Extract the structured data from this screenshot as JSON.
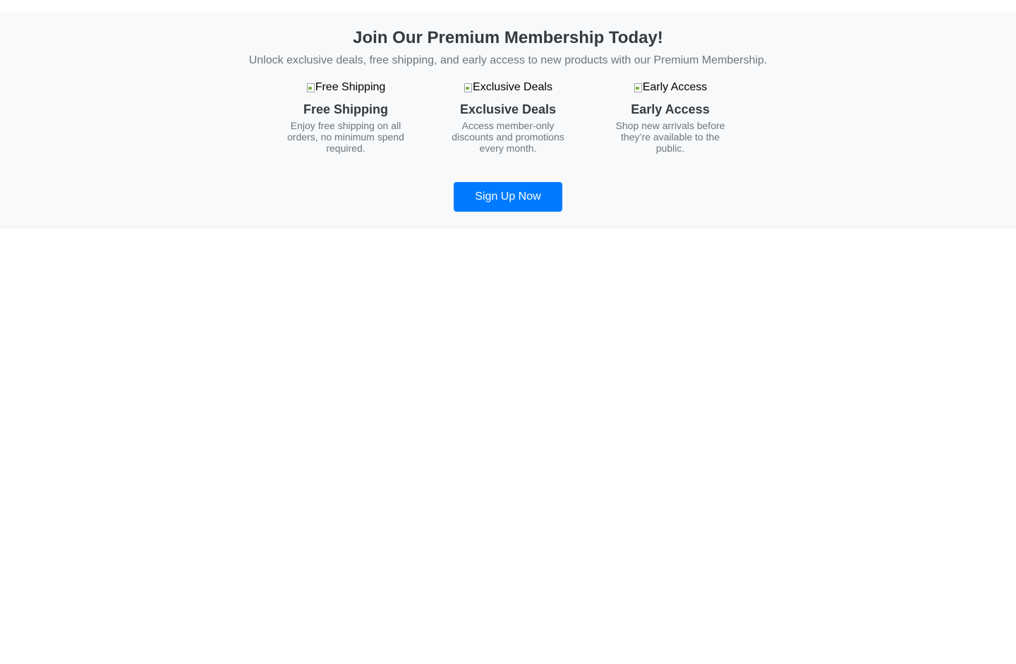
{
  "promo": {
    "title": "Join Our Premium Membership Today!",
    "subtitle": "Unlock exclusive deals, free shipping, and early access to new products with our Premium Membership.",
    "benefits": [
      {
        "image_alt": "Free Shipping",
        "title": "Free Shipping",
        "description": "Enjoy free shipping on all orders, no minimum spend required."
      },
      {
        "image_alt": "Exclusive Deals",
        "title": "Exclusive Deals",
        "description": "Access member-only discounts and promotions every month."
      },
      {
        "image_alt": "Early Access",
        "title": "Early Access",
        "description": "Shop new arrivals before they’re available to the public."
      }
    ],
    "cta_label": "Sign Up Now"
  },
  "colors": {
    "accent": "#007bff",
    "section_background": "#f8f9fa",
    "heading": "#343a40",
    "muted_text": "#6c757d"
  },
  "icons": {
    "benefit_image": "broken-image-icon"
  }
}
